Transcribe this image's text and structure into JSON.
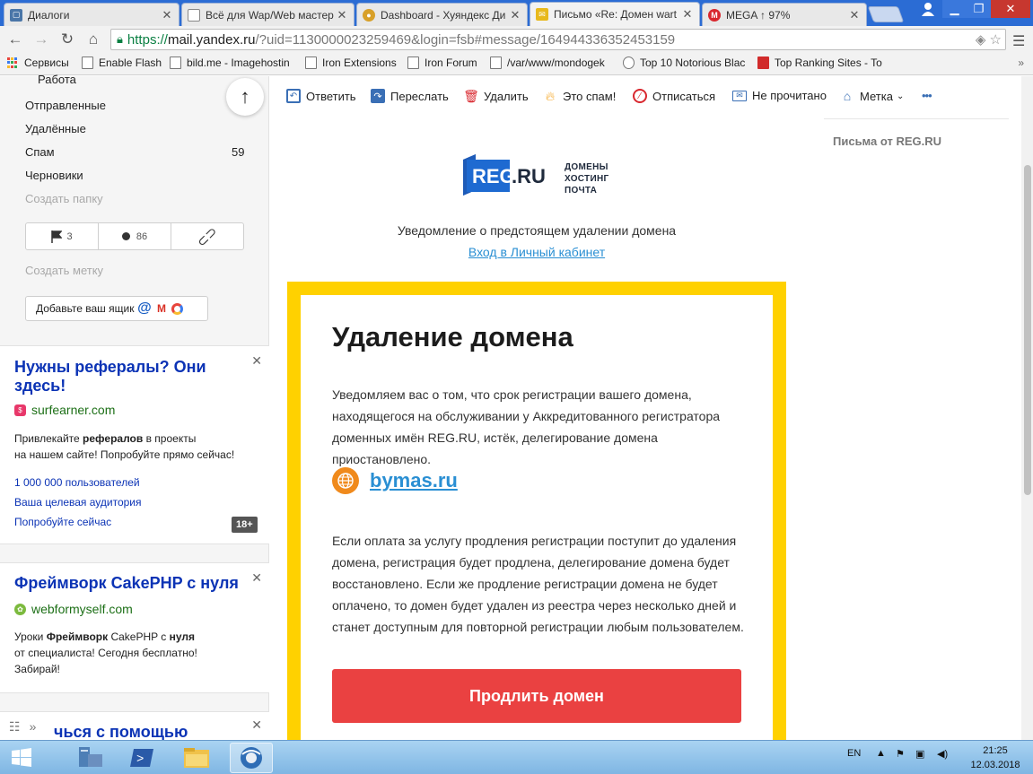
{
  "browser": {
    "tabs": [
      {
        "title": "Диалоги",
        "active": false
      },
      {
        "title": "Всё для Wap/Web мастер",
        "active": false
      },
      {
        "title": "Dashboard - Хуяндекс Ди",
        "active": false
      },
      {
        "title": "Письмо «Re: Домен wart",
        "active": true
      },
      {
        "title": "MEGA ↑ 97%",
        "active": false
      }
    ],
    "url": {
      "scheme": "https://",
      "host": "mail.yandex.ru",
      "rest": "/?uid=1130000023259469&login=fsb#message/164944336352453159"
    },
    "bookmarks": [
      {
        "label": "Сервисы",
        "icon": "apps-icon"
      },
      {
        "label": "Enable Flash",
        "icon": "page-icon"
      },
      {
        "label": "bild.me - Imagehostin",
        "icon": "page-icon"
      },
      {
        "label": "Iron Extensions",
        "icon": "page-icon"
      },
      {
        "label": "Iron Forum",
        "icon": "page-icon"
      },
      {
        "label": "/var/www/mondogek",
        "icon": "page-icon"
      },
      {
        "label": "Top 10 Notorious Blac",
        "icon": "wiki-icon"
      },
      {
        "label": "Top Ranking Sites - To",
        "icon": "twenty-icon"
      }
    ],
    "bookmarks_overflow": "»"
  },
  "sidebar": {
    "partial_folder": "Работа",
    "folders": [
      {
        "label": "Отправленные",
        "count": ""
      },
      {
        "label": "Удалённые",
        "count": ""
      },
      {
        "label": "Спам",
        "count": "59"
      },
      {
        "label": "Черновики",
        "count": ""
      }
    ],
    "create_folder": "Создать папку",
    "filters": {
      "flagged": "3",
      "unread": "86"
    },
    "create_label": "Создать метку",
    "add_mailbox": "Добавьте ваш ящик"
  },
  "ads": [
    {
      "title": "Нужны рефералы? Они здесь!",
      "domain": "surfearner.com",
      "text_a": "Привлекайте ",
      "text_bold": "рефералов",
      "text_b": " в проекты",
      "text_c": "на нашем сайте! Попробуйте прямо сейчас!",
      "links": [
        "1 000 000 пользователей",
        "Ваша целевая аудитория",
        "Попробуйте сейчас"
      ],
      "age": "18+"
    },
    {
      "title": "Фреймворк CakePHP с нуля",
      "domain": "webformyself.com",
      "text_a": "Уроки ",
      "text_bold": "Фреймворк",
      "text_b": " CakePHP с ",
      "text_bold2": "нуля",
      "text_c": "от специалиста! Сегодня бесплатно!",
      "text_d": "Забирай!"
    },
    {
      "title_partial": "чься с помощью"
    }
  ],
  "message_toolbar": {
    "reply": "Ответить",
    "forward": "Переслать",
    "delete": "Удалить",
    "spam": "Это спам!",
    "unsubscribe": "Отписаться",
    "unread": "Не прочитано",
    "label": "Метка",
    "more": "•••"
  },
  "right_panel": {
    "title": "Письма от REG.RU"
  },
  "email": {
    "logo": {
      "brand": "REG.RU",
      "line1": "ДОМЕНЫ",
      "line2": "ХОСТИНГ",
      "line3": "ПОЧТА"
    },
    "notice": "Уведомление о предстоящем удалении домена",
    "cabinet_link": "Вход в Личный кабинет",
    "heading": "Удаление домена",
    "para1": "Уведомляем вас о том, что срок регистрации вашего домена, находящегося на обслуживании у Аккредитованного регистратора доменных имён REG.RU, истёк, делегирование домена приостановлено.",
    "domain": "bymas.ru",
    "para2": "Если оплата за услугу продления регистрации поступит до удаления домена, регистрация будет продлена, делегирование домена будет восстановлено. Если же продление регистрации домена не будет оплачено, то домен будет удален из реестра через несколько дней и станет доступным для повторной регистрации любым пользователем.",
    "button": "Продлить домен"
  },
  "taskbar": {
    "lang": "EN",
    "time": "21:25",
    "date": "12.03.2018"
  },
  "colors": {
    "brand_yellow": "#ffd100",
    "renew_red": "#ea4141",
    "link_blue": "#2a8fd3",
    "ad_title_blue": "#0b33b5",
    "ad_green": "#1c6f16"
  }
}
